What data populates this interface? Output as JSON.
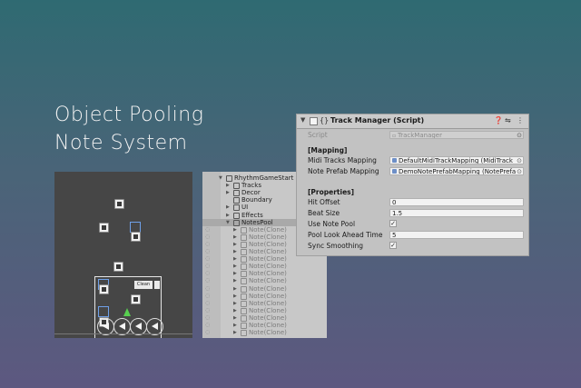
{
  "heading": {
    "line1": "Object Pooling",
    "line2": "Note System"
  },
  "scene": {
    "tag_label": "Clean"
  },
  "hierarchy": {
    "items": [
      {
        "label": "RhythmGameStart",
        "indent": 0,
        "expanded": true,
        "dim": false
      },
      {
        "label": "Tracks",
        "indent": 1,
        "expanded": false,
        "dim": false
      },
      {
        "label": "Decor",
        "indent": 1,
        "expanded": false,
        "dim": false
      },
      {
        "label": "Boundary",
        "indent": 1,
        "expanded": null,
        "dim": false
      },
      {
        "label": "UI",
        "indent": 1,
        "expanded": false,
        "dim": false
      },
      {
        "label": "Effects",
        "indent": 1,
        "expanded": false,
        "dim": false
      },
      {
        "label": "NotesPool",
        "indent": 1,
        "expanded": true,
        "dim": false,
        "selected": true
      },
      {
        "label": "Note(Clone)",
        "indent": 2,
        "expanded": false,
        "dim": true
      },
      {
        "label": "Note(Clone)",
        "indent": 2,
        "expanded": false,
        "dim": true
      },
      {
        "label": "Note(Clone)",
        "indent": 2,
        "expanded": false,
        "dim": true
      },
      {
        "label": "Note(Clone)",
        "indent": 2,
        "expanded": false,
        "dim": true
      },
      {
        "label": "Note(Clone)",
        "indent": 2,
        "expanded": false,
        "dim": true
      },
      {
        "label": "Note(Clone)",
        "indent": 2,
        "expanded": false,
        "dim": true
      },
      {
        "label": "Note(Clone)",
        "indent": 2,
        "expanded": false,
        "dim": true
      },
      {
        "label": "Note(Clone)",
        "indent": 2,
        "expanded": false,
        "dim": true
      },
      {
        "label": "Note(Clone)",
        "indent": 2,
        "expanded": false,
        "dim": true
      },
      {
        "label": "Note(Clone)",
        "indent": 2,
        "expanded": false,
        "dim": true
      },
      {
        "label": "Note(Clone)",
        "indent": 2,
        "expanded": false,
        "dim": true
      },
      {
        "label": "Note(Clone)",
        "indent": 2,
        "expanded": false,
        "dim": true
      },
      {
        "label": "Note(Clone)",
        "indent": 2,
        "expanded": false,
        "dim": true
      },
      {
        "label": "Note(Clone)",
        "indent": 2,
        "expanded": false,
        "dim": true
      },
      {
        "label": "Note(Clone)",
        "indent": 2,
        "expanded": false,
        "dim": true
      }
    ]
  },
  "inspector": {
    "title": "Track Manager (Script)",
    "script_label": "Script",
    "script_value": "TrackManager",
    "mapping_header": "[Mapping]",
    "midi_label": "Midi Tracks Mapping",
    "midi_value": "DefaultMidiTrackMapping (MidiTrack",
    "prefab_label": "Note Prefab Mapping",
    "prefab_value": "DemoNotePrefabMapping (NotePrefa",
    "properties_header": "[Properties]",
    "hit_offset_label": "Hit Offset",
    "hit_offset_value": "0",
    "beat_size_label": "Beat Size",
    "beat_size_value": "1.5",
    "use_pool_label": "Use Note Pool",
    "use_pool_checked": true,
    "lookahead_label": "Pool Look Ahead Time",
    "lookahead_value": "5",
    "sync_label": "Sync Smoothing",
    "sync_checked": true
  }
}
